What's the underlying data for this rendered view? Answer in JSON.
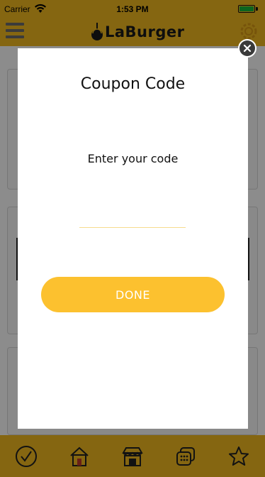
{
  "status_bar": {
    "carrier": "Carrier",
    "time": "1:53 PM",
    "battery_color": "#19b93a"
  },
  "header": {
    "brand": "LaBurger",
    "menu_icon": "hamburger-menu-icon",
    "settings_icon": "gear-icon",
    "background_color": "#f3ba1f"
  },
  "modal": {
    "title": "Coupon Code",
    "subtitle": "Enter your code",
    "input_value": "",
    "done_label": "DONE",
    "accent_color": "#fcc12f",
    "close_icon": "close-icon"
  },
  "tab_bar": {
    "tabs": [
      {
        "icon": "check-circle-icon"
      },
      {
        "icon": "home-icon"
      },
      {
        "icon": "store-icon"
      },
      {
        "icon": "coupons-icon"
      },
      {
        "icon": "star-icon"
      }
    ]
  }
}
